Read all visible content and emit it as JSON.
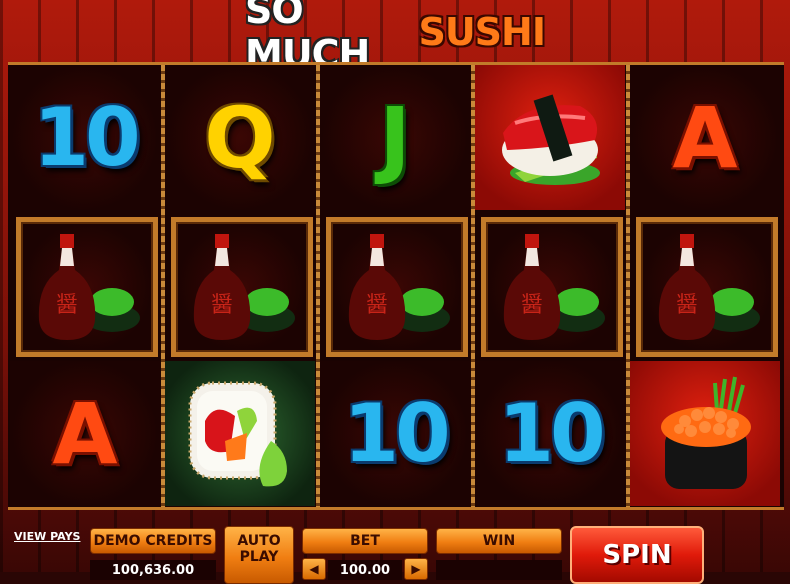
{
  "game": {
    "logo_word1": "SO MUCH",
    "logo_word2": "SUSHI"
  },
  "reels": {
    "row1": [
      {
        "symbol": "ten-icon",
        "text": "10",
        "color": "#29b6ef"
      },
      {
        "symbol": "queen-icon",
        "text": "Q",
        "color": "#ffd200"
      },
      {
        "symbol": "jack-icon",
        "text": "J",
        "color": "#38c31c"
      },
      {
        "symbol": "nigiri-sushi-icon"
      },
      {
        "symbol": "ace-icon",
        "text": "A",
        "color": "#ff4a12"
      }
    ],
    "row2": [
      {
        "symbol": "soy-sauce-wasabi-icon"
      },
      {
        "symbol": "soy-sauce-wasabi-icon"
      },
      {
        "symbol": "soy-sauce-wasabi-icon"
      },
      {
        "symbol": "soy-sauce-wasabi-icon"
      },
      {
        "symbol": "soy-sauce-wasabi-icon"
      }
    ],
    "row3": [
      {
        "symbol": "ace-icon",
        "text": "A",
        "color": "#ff4a12"
      },
      {
        "symbol": "maki-roll-icon"
      },
      {
        "symbol": "ten-icon",
        "text": "10",
        "color": "#29b6ef"
      },
      {
        "symbol": "ten-icon",
        "text": "10",
        "color": "#29b6ef"
      },
      {
        "symbol": "salmon-roe-gunkan-icon"
      }
    ]
  },
  "controls": {
    "view_pays": "VIEW PAYS",
    "demo_credits_label": "DEMO CREDITS",
    "demo_credits_value": "100,636.00",
    "autoplay_line1": "AUTO",
    "autoplay_line2": "PLAY",
    "bet_label": "BET",
    "bet_value": "100.00",
    "win_label": "WIN",
    "win_value": "",
    "spin_label": "SPIN"
  },
  "colors": {
    "accent_orange": "#f07e12",
    "spin_red": "#e01a0a",
    "frame_bamboo": "#c27b2a"
  }
}
